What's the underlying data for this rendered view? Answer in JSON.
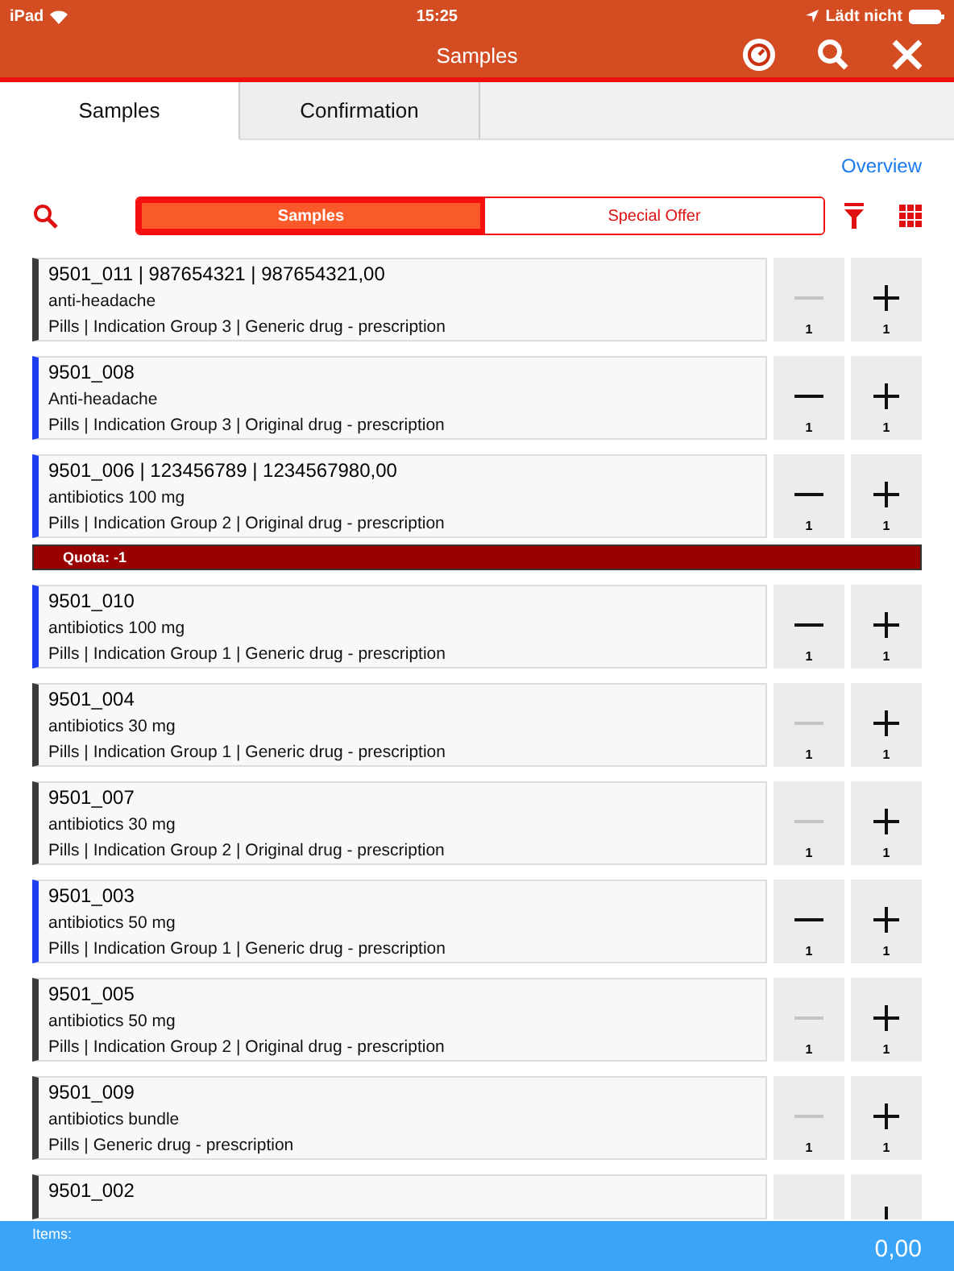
{
  "status_bar": {
    "device": "iPad",
    "time": "15:25",
    "charging": "Lädt nicht"
  },
  "nav_bar": {
    "title": "Samples"
  },
  "tabs": [
    {
      "label": "Samples",
      "selected": true
    },
    {
      "label": "Confirmation",
      "selected": false
    }
  ],
  "overview_link": "Overview",
  "segments": [
    {
      "label": "Samples",
      "selected": true
    },
    {
      "label": "Special Offer",
      "selected": false
    }
  ],
  "items": [
    {
      "title": "9501_011 | 987654321 | 987654321,00",
      "name": "anti-headache",
      "info": "Pills | Indication Group 3 | Generic drug - prescription",
      "color": "#3a3a3a",
      "minus_disabled": true,
      "minus_count": "1",
      "plus_count": "1"
    },
    {
      "title": "9501_008",
      "name": "Anti-headache",
      "info": "Pills | Indication Group 3 | Original drug - prescription",
      "color": "#1f3df0",
      "minus_disabled": false,
      "minus_count": "1",
      "plus_count": "1"
    },
    {
      "title": "9501_006 | 123456789 | 1234567980,00",
      "name": "antibiotics 100 mg",
      "info": "Pills | Indication Group 2 | Original drug - prescription",
      "color": "#1f3df0",
      "minus_disabled": false,
      "minus_count": "1",
      "plus_count": "1",
      "quota": "Quota: -1"
    },
    {
      "title": "9501_010",
      "name": "antibiotics 100 mg",
      "info": "Pills | Indication Group 1 | Generic drug - prescription",
      "color": "#1f3df0",
      "minus_disabled": false,
      "minus_count": "1",
      "plus_count": "1"
    },
    {
      "title": "9501_004",
      "name": "antibiotics 30 mg",
      "info": "Pills | Indication Group 1 | Generic drug - prescription",
      "color": "#3a3a3a",
      "minus_disabled": true,
      "minus_count": "1",
      "plus_count": "1"
    },
    {
      "title": "9501_007",
      "name": "antibiotics 30 mg",
      "info": "Pills | Indication Group 2 | Original drug - prescription",
      "color": "#3a3a3a",
      "minus_disabled": true,
      "minus_count": "1",
      "plus_count": "1"
    },
    {
      "title": "9501_003",
      "name": "antibiotics 50 mg",
      "info": "Pills | Indication Group 1 | Generic drug - prescription",
      "color": "#1f3df0",
      "minus_disabled": false,
      "minus_count": "1",
      "plus_count": "1"
    },
    {
      "title": "9501_005",
      "name": "antibiotics 50 mg",
      "info": "Pills | Indication Group 2 | Original drug - prescription",
      "color": "#3a3a3a",
      "minus_disabled": true,
      "minus_count": "1",
      "plus_count": "1"
    },
    {
      "title": "9501_009",
      "name": "antibiotics bundle",
      "info": "Pills | Generic drug - prescription",
      "color": "#3a3a3a",
      "minus_disabled": true,
      "minus_count": "1",
      "plus_count": "1"
    },
    {
      "title": "9501_002",
      "color": "#3a3a3a"
    }
  ],
  "footer": {
    "label": "Items:",
    "total": "0,00"
  }
}
